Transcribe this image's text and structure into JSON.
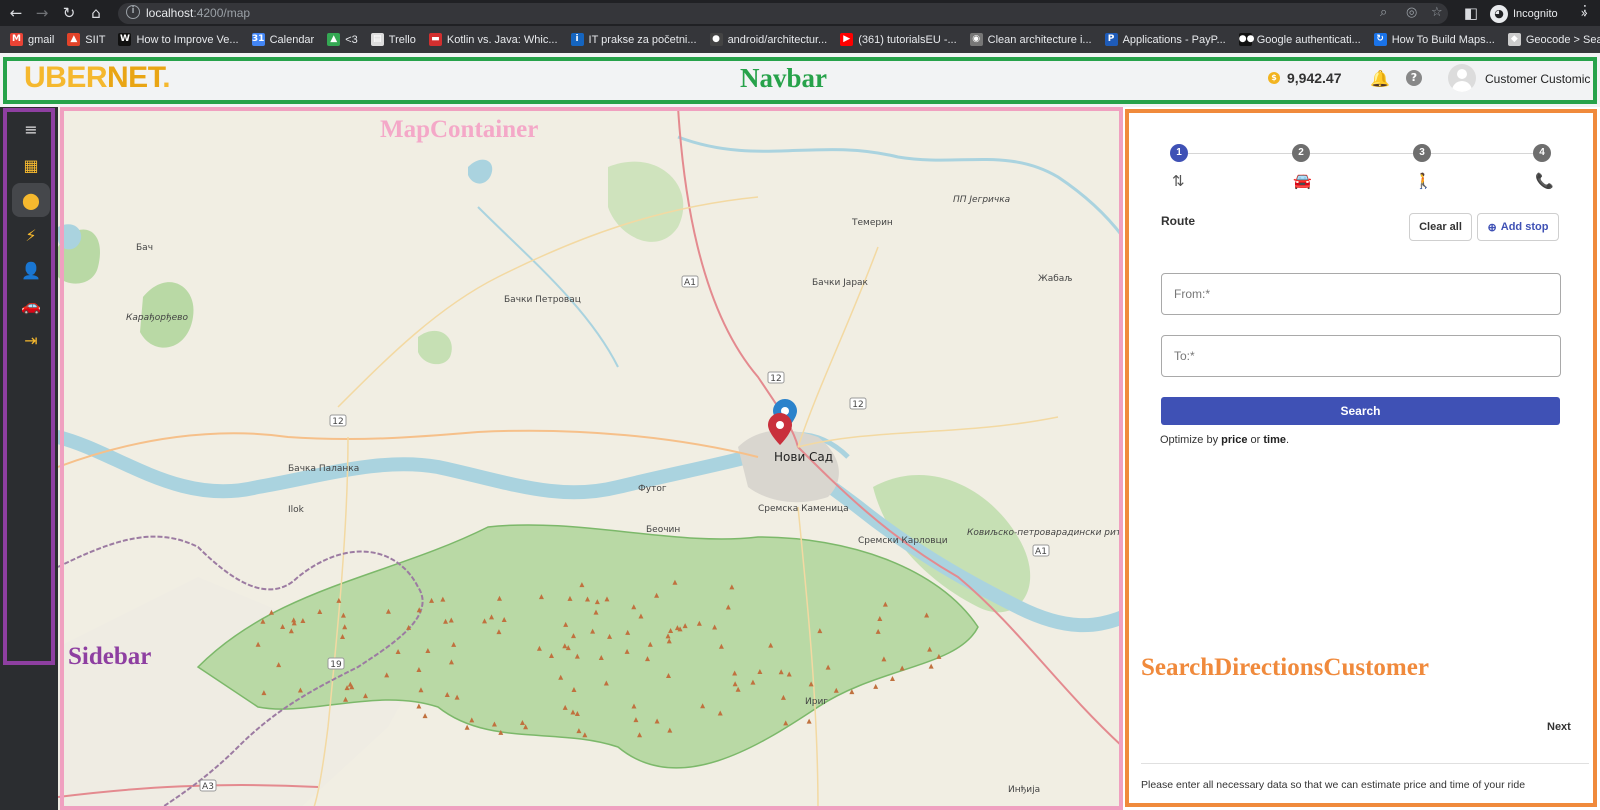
{
  "browser": {
    "url_host": "localhost",
    "url_path": ":4200/map",
    "profile_label": "Incognito",
    "bookmarks": [
      {
        "label": "gmail",
        "icon": "gmail-icon",
        "color": "#ea4335",
        "glyph": "M"
      },
      {
        "label": "SIIT",
        "icon": "gitlab-icon",
        "color": "#e24329",
        "glyph": "▲"
      },
      {
        "label": "How to Improve Ve...",
        "icon": "w-icon",
        "color": "#111111",
        "glyph": "W"
      },
      {
        "label": "Calendar",
        "icon": "calendar-icon",
        "color": "#4285f4",
        "glyph": "31"
      },
      {
        "label": "<3",
        "icon": "drive-icon",
        "color": "#34a853",
        "glyph": "▲"
      },
      {
        "label": "Trello",
        "icon": "trello-icon",
        "color": "#dddddd",
        "glyph": "▤"
      },
      {
        "label": "Kotlin vs. Java: Whic...",
        "icon": "news-icon",
        "color": "#d32f2f",
        "glyph": "▬"
      },
      {
        "label": "IT prakse za početni...",
        "icon": "it-icon",
        "color": "#1565c0",
        "glyph": "i"
      },
      {
        "label": "android/architectur...",
        "icon": "github-icon",
        "color": "#444444",
        "glyph": "●"
      },
      {
        "label": "(361) tutorialsEU -...",
        "icon": "youtube-icon",
        "color": "#ff0000",
        "glyph": "▶"
      },
      {
        "label": "Clean architecture i...",
        "icon": "globe-icon",
        "color": "#777777",
        "glyph": "◉"
      },
      {
        "label": "Applications - PayP...",
        "icon": "paypal-icon",
        "color": "#1e5bb8",
        "glyph": "P"
      },
      {
        "label": "Google authenticati...",
        "icon": "medium-icon",
        "color": "#111111",
        "glyph": "●●"
      },
      {
        "label": "How To Build Maps...",
        "icon": "refresh-site-icon",
        "color": "#1a73e8",
        "glyph": "↻"
      },
      {
        "label": "Geocode > Search...",
        "icon": "geocode-icon",
        "color": "#cccccc",
        "glyph": "◆"
      }
    ]
  },
  "navbar": {
    "logo_main": "UBER",
    "logo_accent": "NET",
    "logo_dot": ".",
    "annotation": "Navbar",
    "balance_symbol": "$",
    "balance": "9,942.47",
    "username": "Customer Customic"
  },
  "sidebar": {
    "annotation": "Sidebar",
    "items": [
      {
        "icon": "menu-icon",
        "glyph": "≡"
      },
      {
        "icon": "dashboard-icon",
        "glyph": "▦"
      },
      {
        "icon": "location-pin-icon",
        "glyph": "⬤"
      },
      {
        "icon": "analytics-icon",
        "glyph": "⚡"
      },
      {
        "icon": "person-icon",
        "glyph": "👤"
      },
      {
        "icon": "car-icon",
        "glyph": "🚗"
      },
      {
        "icon": "logout-icon",
        "glyph": "⇥"
      }
    ]
  },
  "map": {
    "annotation": "MapContainer",
    "places": [
      "Бач",
      "Бачки Петровац",
      "Темерин",
      "Бачки Јарак",
      "Жабаљ",
      "Бачка Паланка",
      "Футог",
      "Нови Сад",
      "Ilok",
      "Беочин",
      "Сремска Каменица",
      "Сремски Карловци",
      "Ириг",
      "Инђија",
      "Карађорђево",
      "ПП Јегричка",
      "Ковиљско-петроварадински рит"
    ],
    "roads": [
      "A1",
      "A1",
      "12",
      "12",
      "19",
      "A3",
      "12"
    ]
  },
  "panel": {
    "annotation": "SearchDirectionsCustomer",
    "steps": [
      "1",
      "2",
      "3",
      "4"
    ],
    "route_label": "Route",
    "clear_all": "Clear all",
    "add_stop": "Add stop",
    "from_placeholder": "From:*",
    "to_placeholder": "To:*",
    "search": "Search",
    "optimize_prefix": "Optimize by ",
    "optimize_price": "price",
    "optimize_or": " or ",
    "optimize_time": "time",
    "optimize_suffix": ".",
    "next": "Next",
    "hint": "Please enter all necessary data so that we can estimate price and time of your ride"
  }
}
